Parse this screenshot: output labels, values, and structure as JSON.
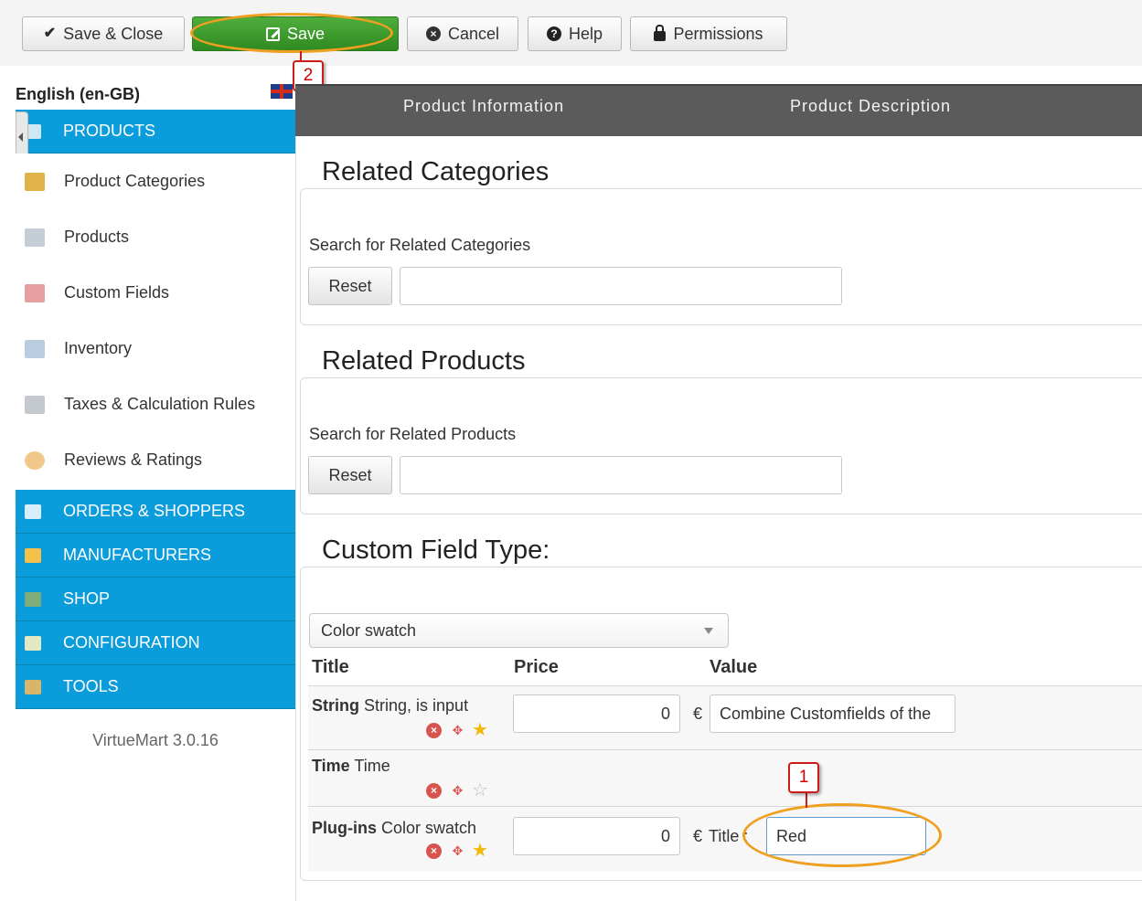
{
  "toolbar": {
    "save_close": "Save & Close",
    "save": "Save",
    "cancel": "Cancel",
    "help": "Help",
    "permissions": "Permissions"
  },
  "callouts": {
    "one": "1",
    "two": "2"
  },
  "language": "English (en-GB)",
  "sidebar": {
    "products_header": "PRODUCTS",
    "items": [
      {
        "label": "Product Categories",
        "icon": "folder-icon"
      },
      {
        "label": "Products",
        "icon": "product-icon"
      },
      {
        "label": "Custom Fields",
        "icon": "custom-fields-icon"
      },
      {
        "label": "Inventory",
        "icon": "inventory-icon"
      },
      {
        "label": "Taxes & Calculation Rules",
        "icon": "calculator-icon"
      },
      {
        "label": "Reviews & Ratings",
        "icon": "speech-bubble-icon"
      }
    ],
    "sections": [
      {
        "label": "ORDERS & SHOPPERS",
        "icon": "orders-icon"
      },
      {
        "label": "MANUFACTURERS",
        "icon": "wrench-icon"
      },
      {
        "label": "SHOP",
        "icon": "shop-icon"
      },
      {
        "label": "CONFIGURATION",
        "icon": "configuration-icon"
      },
      {
        "label": "TOOLS",
        "icon": "tools-icon"
      }
    ],
    "version": "VirtueMart 3.0.16"
  },
  "tabs": [
    "Product Information",
    "Product Description"
  ],
  "related_categories": {
    "legend": "Related Categories",
    "search_label": "Search for Related Categories",
    "reset": "Reset",
    "value": ""
  },
  "related_products": {
    "legend": "Related Products",
    "search_label": "Search for Related Products",
    "reset": "Reset",
    "value": ""
  },
  "custom_field": {
    "legend": "Custom Field Type:",
    "selected": "Color swatch",
    "columns": [
      "Title",
      "Price",
      "Value"
    ],
    "rows": [
      {
        "type": "String",
        "name": "String, is input",
        "price": "0",
        "currency": "€",
        "value": "Combine Customfields of the",
        "starred": true
      },
      {
        "type": "Time",
        "name": "Time",
        "starred": false
      },
      {
        "type": "Plug-ins",
        "name": "Color swatch",
        "price": "0",
        "currency": "€",
        "value_label": "Title :",
        "value": "Red",
        "starred": true
      }
    ]
  },
  "colors": {
    "accent_blue": "#0b9ddb",
    "save_green": "#3a9a2a",
    "tab_bar": "#5b5b5b",
    "callout_orange": "#f0a020",
    "callout_red": "#cc1c1c"
  }
}
